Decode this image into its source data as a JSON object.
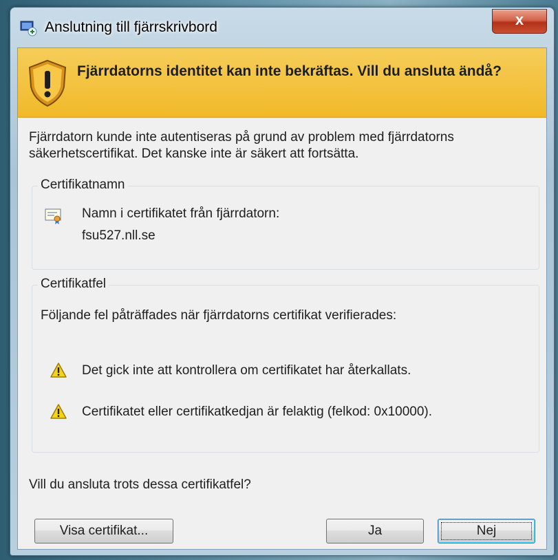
{
  "window": {
    "title": "Anslutning till fjärrskrivbord",
    "close_label": "x"
  },
  "banner": {
    "text": "Fjärrdatorns identitet kan inte bekräftas. Vill du ansluta ändå?"
  },
  "intro": "Fjärrdatorn kunde inte autentiseras på grund av problem med fjärrdatorns säkerhetscertifikat. Det kanske inte är säkert att fortsätta.",
  "cert_name_group": {
    "legend": "Certifikatnamn",
    "label": "Namn i certifikatet från fjärrdatorn:",
    "value": "fsu527.nll.se"
  },
  "cert_error_group": {
    "legend": "Certifikatfel",
    "intro": "Följande fel påträffades när fjärrdatorns certifikat verifierades:",
    "errors": [
      "Det gick inte att kontrollera om certifikatet har återkallats.",
      "Certifikatet eller certifikatkedjan är felaktig (felkod: 0x10000)."
    ]
  },
  "question": "Vill du ansluta trots dessa certifikatfel?",
  "buttons": {
    "view_cert": "Visa certifikat...",
    "yes": "Ja",
    "no": "Nej"
  },
  "colors": {
    "banner": "#f3c23a",
    "close_button": "#c9402a",
    "warning": "#f5d21c"
  }
}
